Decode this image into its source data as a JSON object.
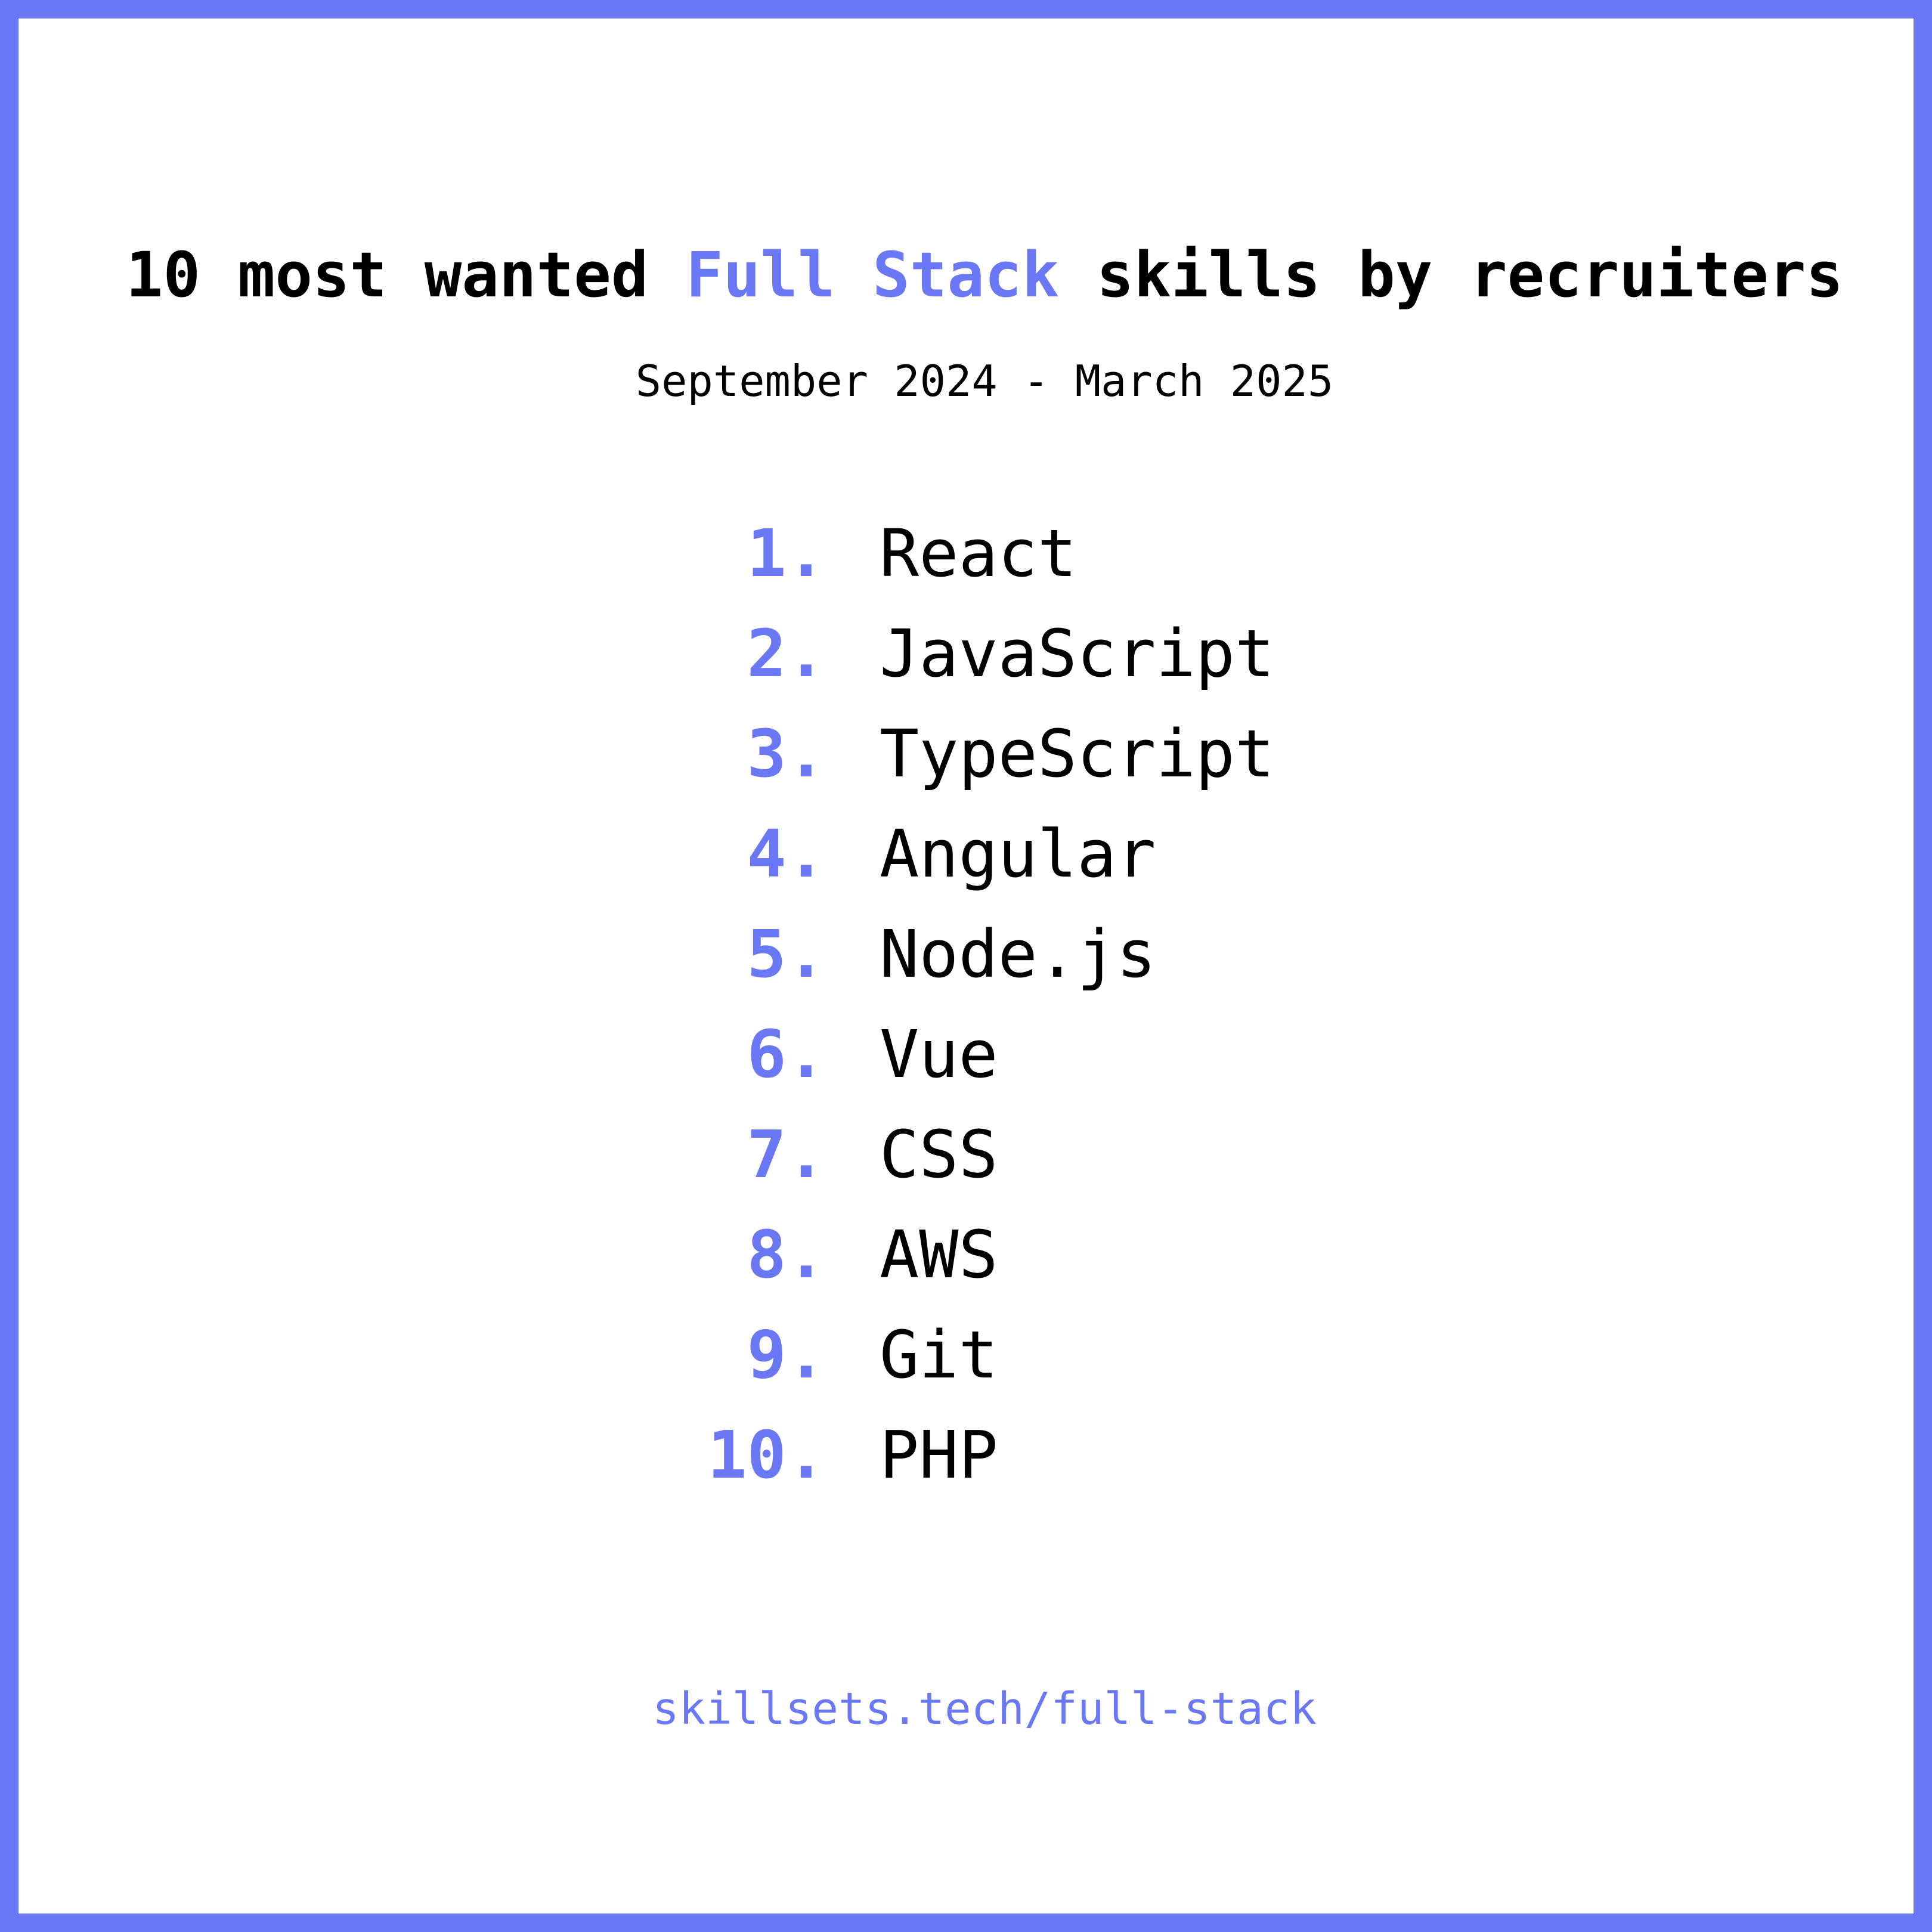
{
  "title": {
    "prefix": "10 most wanted ",
    "highlight": "Full Stack",
    "suffix": " skills by recruiters"
  },
  "subtitle": "September 2024 - March 2025",
  "skills": [
    {
      "rank": "1.",
      "name": "React"
    },
    {
      "rank": "2.",
      "name": "JavaScript"
    },
    {
      "rank": "3.",
      "name": "TypeScript"
    },
    {
      "rank": "4.",
      "name": "Angular"
    },
    {
      "rank": "5.",
      "name": "Node.js"
    },
    {
      "rank": "6.",
      "name": "Vue"
    },
    {
      "rank": "7.",
      "name": "CSS"
    },
    {
      "rank": "8.",
      "name": "AWS"
    },
    {
      "rank": "9.",
      "name": "Git"
    },
    {
      "rank": "10.",
      "name": "PHP"
    }
  ],
  "footer": "skillsets.tech/full-stack",
  "colors": {
    "accent": "#6b78f5",
    "text": "#000000",
    "background": "#ffffff"
  }
}
